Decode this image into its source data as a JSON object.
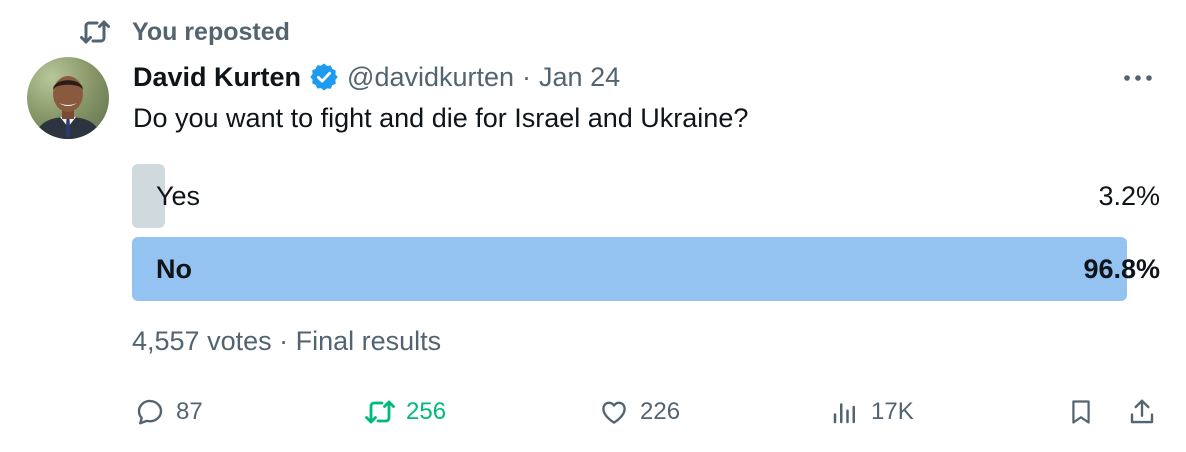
{
  "repost_banner": {
    "label": "You reposted"
  },
  "author": {
    "name": "David Kurten",
    "handle": "@davidkurten",
    "separator": "·",
    "date": "Jan 24"
  },
  "tweet": {
    "text": "Do you want to fight and die for Israel and Ukraine?"
  },
  "poll": {
    "options": [
      {
        "label": "Yes",
        "percent_text": "3.2%",
        "fill_fraction": 0.032
      },
      {
        "label": "No",
        "percent_text": "96.8%",
        "fill_fraction": 0.968
      }
    ],
    "votes_text": "4,557 votes · Final results"
  },
  "actions": {
    "replies": "87",
    "reposts": "256",
    "likes": "226",
    "views": "17K"
  },
  "icons": {
    "repost_banner": "repost-icon",
    "verified": "verified-badge-icon",
    "more": "more-icon",
    "reply": "reply-icon",
    "repost": "repost-icon",
    "like": "heart-icon",
    "views": "views-icon",
    "bookmark": "bookmark-icon",
    "share": "share-icon"
  },
  "colors": {
    "verified_blue": "#1d9bf0",
    "repost_green": "#00ba7c",
    "poll_winner": "#94c2f1",
    "poll_other": "#cfd9de",
    "secondary_text": "#536471"
  }
}
